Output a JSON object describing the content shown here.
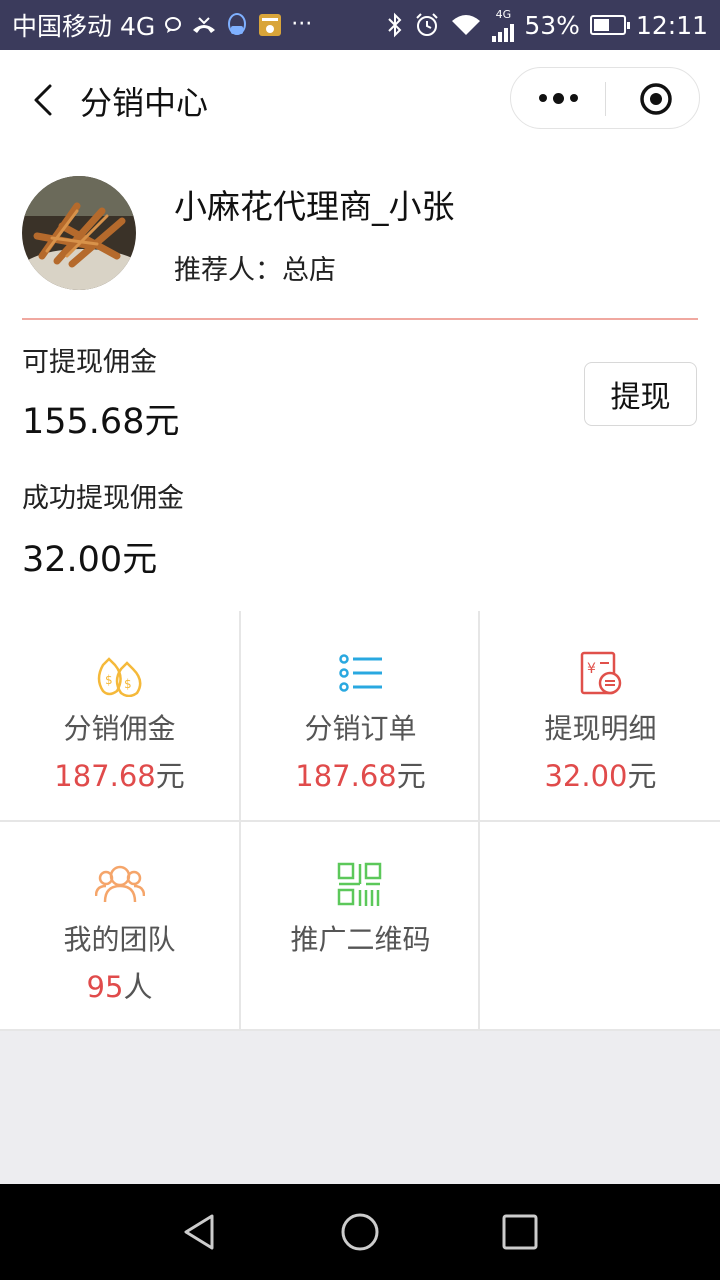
{
  "status_bar": {
    "carrier": "中国移动 4G",
    "network_badge": "4G",
    "battery_percent": "53%",
    "battery_level": 0.53,
    "time": "12:11"
  },
  "header": {
    "title": "分销中心"
  },
  "profile": {
    "name": "小麻花代理商_小张",
    "referrer": "推荐人：总店"
  },
  "commission": {
    "available_label": "可提现佣金",
    "available_value": "155.68元",
    "withdraw_button": "提现",
    "success_label": "成功提现佣金",
    "success_value": "32.00元"
  },
  "grid": [
    {
      "icon": "money-bags-icon",
      "label": "分销佣金",
      "value": "187.68",
      "unit": "元",
      "color": "#f5b93a"
    },
    {
      "icon": "list-icon",
      "label": "分销订单",
      "value": "187.68",
      "unit": "元",
      "color": "#29a8e0"
    },
    {
      "icon": "withdraw-detail-icon",
      "label": "提现明细",
      "value": "32.00",
      "unit": "元",
      "color": "#e0504a"
    },
    {
      "icon": "team-icon",
      "label": "我的团队",
      "value": "95",
      "unit": "人",
      "color": "#f5a56a"
    },
    {
      "icon": "qr-code-icon",
      "label": "推广二维码",
      "color": "#5cc85a"
    }
  ],
  "colors": {
    "accent_red": "#e04b4b",
    "divider": "#f0a8a0",
    "status_bar": "#3b3b5c"
  }
}
